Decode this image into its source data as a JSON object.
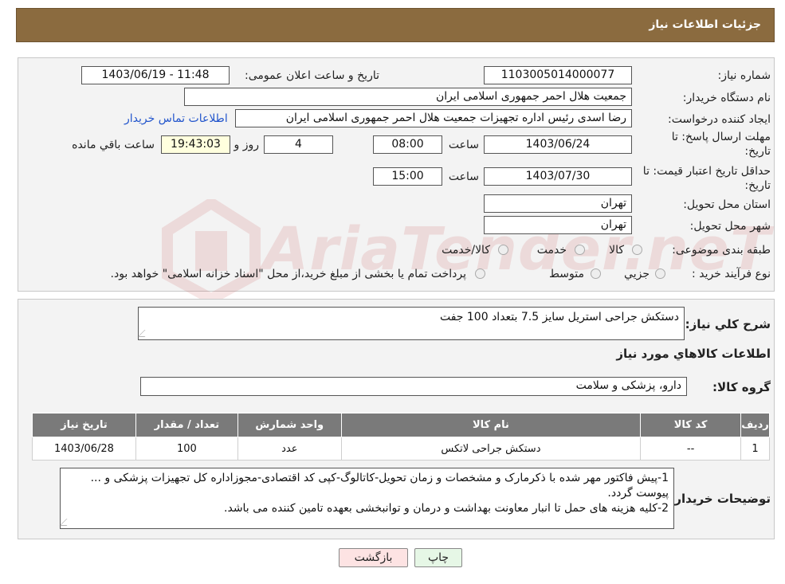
{
  "header": {
    "title": "جزئیات اطلاعات نیاز"
  },
  "form": {
    "need_number_label": "شماره نیاز:",
    "need_number": "1103005014000077",
    "announce_label": "تاریخ و ساعت اعلان عمومی:",
    "announce_value": "1403/06/19 - 11:48",
    "buyer_org_label": "نام دستگاه خریدار:",
    "buyer_org": "جمعیت هلال احمر جمهوری اسلامی ایران",
    "creator_label": "ایجاد کننده درخواست:",
    "creator": "رضا اسدی رئیس اداره تجهیزات جمعیت هلال احمر جمهوری اسلامی ایران",
    "contact_link": "اطلاعات تماس خریدار",
    "deadline_label_1": "مهلت ارسال پاسخ: تا",
    "deadline_label_2": "تاریخ:",
    "deadline_date": "1403/06/24",
    "time_label": "ساعت",
    "deadline_time": "08:00",
    "days_value": "4",
    "days_label": "روز و",
    "remaining_time": "19:43:03",
    "remaining_label": "ساعت باقي مانده",
    "validity_label_1": "حداقل تاریخ اعتبار قیمت: تا",
    "validity_label_2": "تاریخ:",
    "validity_date": "1403/07/30",
    "validity_time": "15:00",
    "province_label": "استان محل تحویل:",
    "province": "تهران",
    "city_label": "شهر محل تحویل:",
    "city": "تهران",
    "category_label": "طبقه بندی موضوعی:",
    "category_options": [
      "کالا",
      "خدمت",
      "کالا/خدمت"
    ],
    "process_label": "نوع فرآیند خرید :",
    "process_options": [
      "جزیي",
      "متوسط"
    ],
    "process_note": "پرداخت تمام یا بخشی از مبلغ خرید،از محل \"اسناد خزانه اسلامی\" خواهد بود."
  },
  "summary": {
    "title_label": "شرح کلي نیاز:",
    "title_value": "دستکش جراحی استریل سایز 7.5 بتعداد 100 جفت",
    "goods_info_title": "اطلاعات کالاهاي مورد نیاز",
    "group_label": "گروه کالا:",
    "group_value": "دارو، پزشکی و سلامت"
  },
  "table": {
    "headers": [
      "ردیف",
      "کد کالا",
      "نام کالا",
      "واحد شمارش",
      "تعداد / مقدار",
      "تاریخ نیاز"
    ],
    "rows": [
      {
        "row": "1",
        "code": "--",
        "name": "دستکش جراحی لاتکس",
        "unit": "عدد",
        "qty": "100",
        "date": "1403/06/28"
      }
    ]
  },
  "buyer_notes": {
    "label": "توضیحات خریدار:",
    "line1": "1-پیش فاکتور مهر شده با ذکرمارک و مشخصات و زمان تحویل-کاتالوگ-کپی کد اقتصادی-مجوزاداره کل تجهیزات پزشکی و ... پیوست گردد.",
    "line2": "2-کلیه هزینه های حمل تا انبار معاونت بهداشت و درمان و توانبخشی بعهده تامین کننده می باشد."
  },
  "buttons": {
    "print": "چاپ",
    "back": "بازگشت"
  },
  "colors": {
    "header_bg": "#8b6b3f",
    "table_header_bg": "#7a7a7a",
    "timer_bg": "#ffffde",
    "back_btn_bg": "#fde3e3",
    "print_btn_bg": "#e6f7e6"
  },
  "watermark": "AriaTender.neT"
}
